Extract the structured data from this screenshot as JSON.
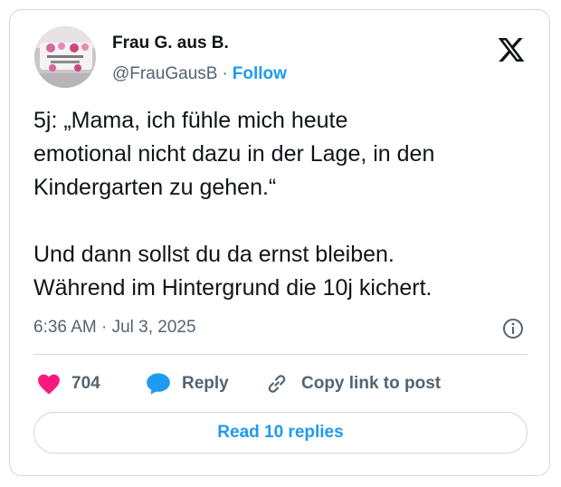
{
  "author": {
    "name": "Frau G. aus B.",
    "handle": "@FrauGausB",
    "separator": "·",
    "follow_label": "Follow"
  },
  "tweet": {
    "paragraphs": [
      [
        "5j: „Mama, ich fühle mich heute",
        "emotional nicht dazu in der Lage, in den",
        "Kindergarten zu gehen.“"
      ],
      [
        "Und dann sollst du da ernst bleiben.",
        "Während im Hintergrund die 10j kichert."
      ]
    ],
    "time": "6:36 AM",
    "date_separator": "·",
    "date": "Jul 3, 2025"
  },
  "actions": {
    "like_count": "704",
    "reply_label": "Reply",
    "copy_label": "Copy link to post"
  },
  "read_replies_label": "Read 10 replies",
  "colors": {
    "accent": "#1d9bf0",
    "like": "#f91880",
    "text": "#0f1419",
    "secondary": "#536471",
    "border": "#cfd9de"
  },
  "icons": [
    "x-logo-icon",
    "info-icon",
    "heart-icon",
    "reply-bubble-icon",
    "link-icon"
  ]
}
